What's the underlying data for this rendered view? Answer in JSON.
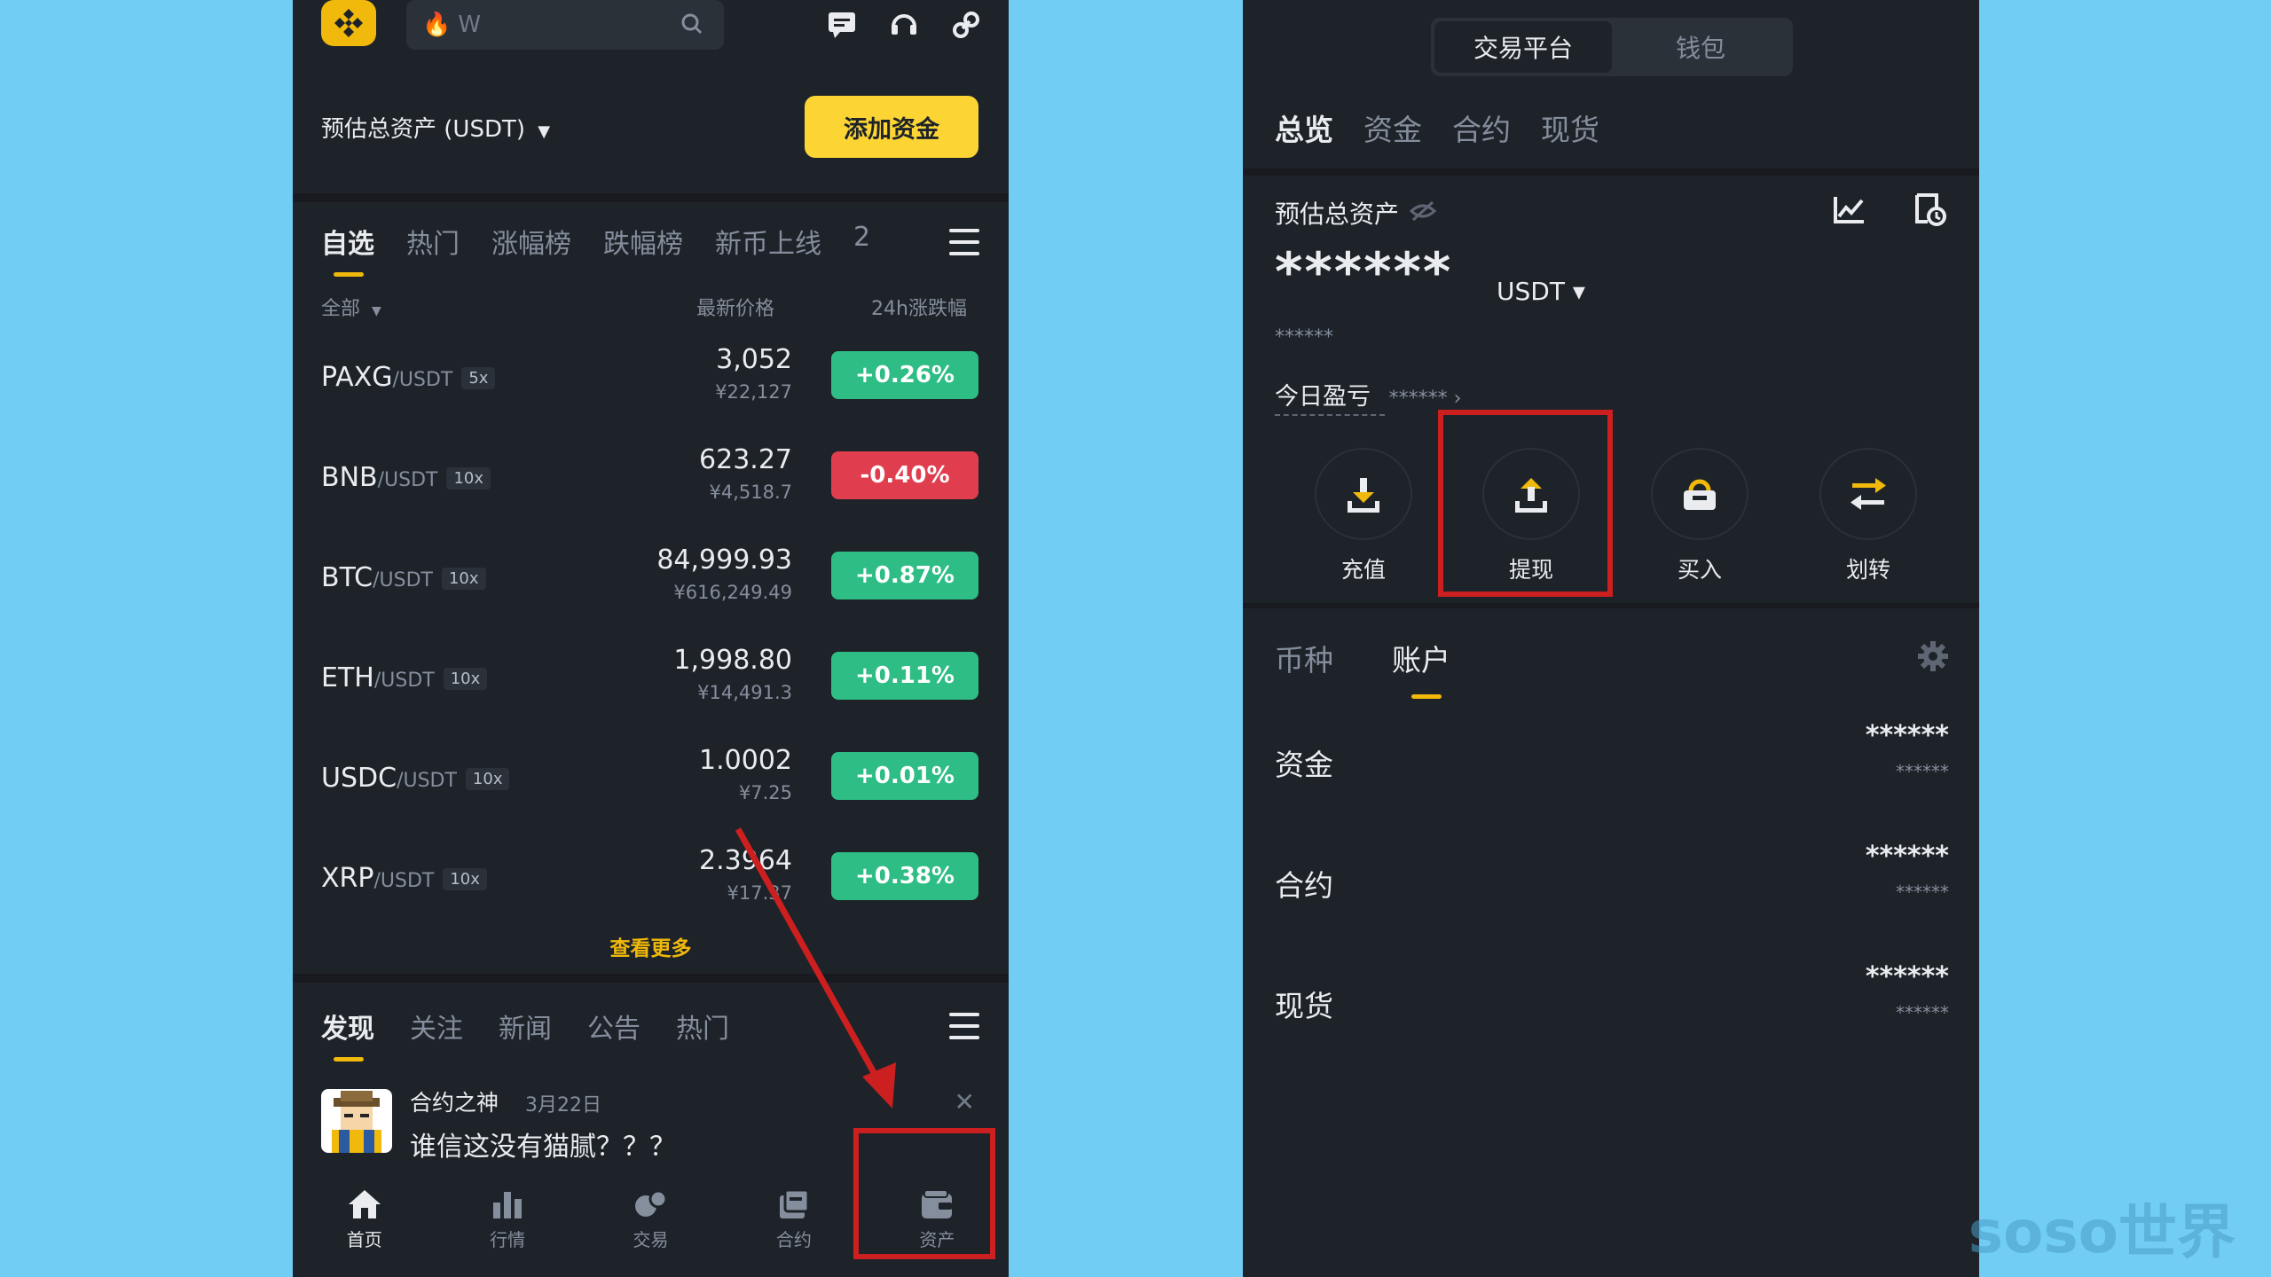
{
  "left": {
    "search_placeholder": "W",
    "asset_label": "预估总资产 (USDT)",
    "add_fund_label": "添加资金",
    "market_tabs": [
      "自选",
      "热门",
      "涨幅榜",
      "跌幅榜",
      "新币上线",
      "2"
    ],
    "filter_label": "全部",
    "col_price": "最新价格",
    "col_change": "24h涨跌幅",
    "rows": [
      {
        "base": "PAXG",
        "quote": "/USDT",
        "lev": "5x",
        "price": "3,052",
        "cny": "¥22,127",
        "change": "+0.26%",
        "dir": "up"
      },
      {
        "base": "BNB",
        "quote": "/USDT",
        "lev": "10x",
        "price": "623.27",
        "cny": "¥4,518.7",
        "change": "-0.40%",
        "dir": "down"
      },
      {
        "base": "BTC",
        "quote": "/USDT",
        "lev": "10x",
        "price": "84,999.93",
        "cny": "¥616,249.49",
        "change": "+0.87%",
        "dir": "up"
      },
      {
        "base": "ETH",
        "quote": "/USDT",
        "lev": "10x",
        "price": "1,998.80",
        "cny": "¥14,491.3",
        "change": "+0.11%",
        "dir": "up"
      },
      {
        "base": "USDC",
        "quote": "/USDT",
        "lev": "10x",
        "price": "1.0002",
        "cny": "¥7.25",
        "change": "+0.01%",
        "dir": "up"
      },
      {
        "base": "XRP",
        "quote": "/USDT",
        "lev": "10x",
        "price": "2.3964",
        "cny": "¥17.37",
        "change": "+0.38%",
        "dir": "up"
      }
    ],
    "see_more": "查看更多",
    "feed_tabs": [
      "发现",
      "关注",
      "新闻",
      "公告",
      "热门"
    ],
    "post": {
      "author": "合约之神",
      "date": "3月22日",
      "text": "谁信这没有猫腻？？？",
      "close": "✕"
    },
    "nav": [
      "首页",
      "行情",
      "交易",
      "合约",
      "资产"
    ]
  },
  "right": {
    "segment": [
      "交易平台",
      "钱包"
    ],
    "tabs": [
      "总览",
      "资金",
      "合约",
      "现货"
    ],
    "est_label": "预估总资产",
    "balance_masked": "******",
    "unit": "USDT ▾",
    "sub_masked": "******",
    "pnl_label": "今日盈亏",
    "pnl_value": "****** ›",
    "actions": [
      "充值",
      "提现",
      "买入",
      "划转"
    ],
    "account_tabs": [
      "币种",
      "账户"
    ],
    "accounts": [
      {
        "name": "资金",
        "v1": "******",
        "v2": "******"
      },
      {
        "name": "合约",
        "v1": "******",
        "v2": "******"
      },
      {
        "name": "现货",
        "v1": "******",
        "v2": "******"
      }
    ]
  },
  "colors": {
    "up": "#2ebd85",
    "down": "#e03e4e",
    "accent": "#fcd535",
    "annotation": "#cc1f1f"
  },
  "watermark": "soso世界"
}
